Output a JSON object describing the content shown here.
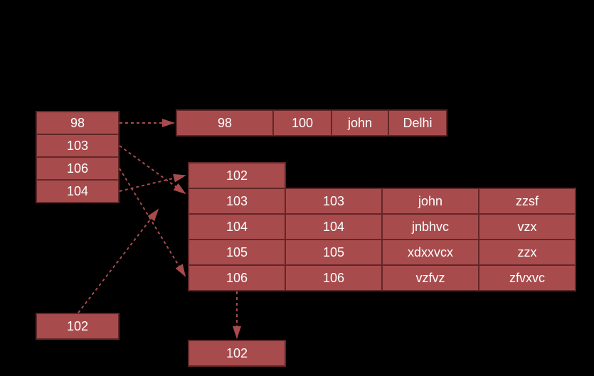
{
  "left_list": {
    "items": [
      "98",
      "103",
      "106",
      "104"
    ]
  },
  "row98": {
    "cells": [
      "98",
      "100",
      "john",
      "Delhi"
    ]
  },
  "block2": {
    "header": "102",
    "rows": [
      [
        "103",
        "103",
        "john",
        "zzsf"
      ],
      [
        "104",
        "104",
        "jnbhvc",
        "vzx"
      ],
      [
        "105",
        "105",
        "xdxxvcx",
        "zzx"
      ],
      [
        "106",
        "106",
        "vzfvz",
        "zfvxvc"
      ]
    ]
  },
  "single102_bottomleft": "102",
  "single102_bottommid": "102",
  "colors": {
    "fill": "#A84B4D",
    "border": "#622627",
    "arrow": "#A84B4D",
    "bg": "#000"
  }
}
